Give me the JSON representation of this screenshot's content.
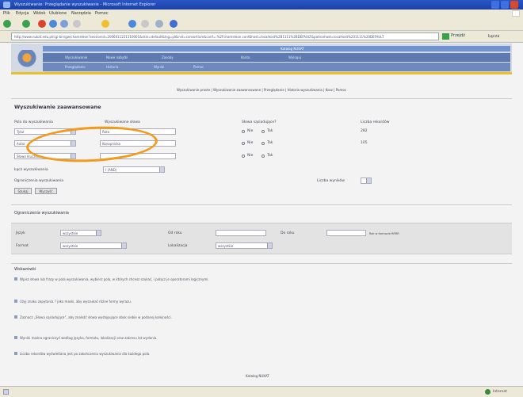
{
  "browser": {
    "title": "Wyszukiwanie: Przeglądanie wyszukiwanie - Microsoft Internet Explorer",
    "menu": [
      "Plik",
      "Edycja",
      "Widok",
      "Ulubione",
      "Narzędzia",
      "Pomoc"
    ],
    "address": "http://www.nukat.edu.pl/cgi-bin/gw/chameleon?sessionid=2006011221110001&skin=default&lng=pl&inst=consortium&conf=.%2Fchameleon.conf&host=localhost%2B1111%2BDEFAULT&patronhost=localhost%201111%20DEFAULT",
    "go_label": "Przejdź",
    "links_label": "Łącza",
    "status_right": "Internet"
  },
  "header": {
    "banner_text": "Katalog NUKAT",
    "nav_row1": [
      "Wyszukiwanie",
      "Nowe nabytki",
      "Zasoby",
      "Konto",
      "Wyloguj"
    ],
    "nav_row2": [
      "Przeglądanie",
      "Historia",
      "Wyniki",
      "Pomoc"
    ]
  },
  "subnav": "Wyszukiwanie proste | Wyszukiwanie zaawansowane | Przeglądanie | Historia wyszukiwania | Kosz | Pomoc",
  "form": {
    "heading": "Wyszukiwanie zaawansowane",
    "col_field": "Pola do wyszukiwania",
    "col_terms": "Wyszukiwane słowa",
    "col_adjacent": "Słowa sąsiadujące?",
    "col_count": "Liczba rekordów",
    "rows": [
      {
        "field": "Tytuł",
        "term": "Rota",
        "yes": "Tak",
        "no": "Nie",
        "count": "282"
      },
      {
        "field": "Autor",
        "term": "Konopnicka",
        "yes": "Tak",
        "no": "Nie",
        "count": "105"
      },
      {
        "field": "Słowo kluczowe",
        "term": "",
        "yes": "Tak",
        "no": "Nie",
        "count": ""
      }
    ],
    "bool_label": "Łącz wyszukiwania",
    "bool_value": "I (AND)",
    "limit_label": "Ograniczenia wyszukiwania",
    "limit_right": "Liczba wyników",
    "submit": "Szukaj",
    "reset": "Wyczyść"
  },
  "filters": {
    "title": "Ograniczenia wyszukiwania",
    "lang_label": "Język",
    "lang_value": "wszystkie",
    "year_from": "Od roku",
    "year_to": "Do roku",
    "format_label": "Format",
    "format_value": "wszystkie",
    "location_label": "Lokalizacja",
    "location_value": "wszystkie",
    "hint": "Rok w formacie RRRR"
  },
  "help": {
    "title": "Wskazówki",
    "items": [
      "Wpisz słowa lub frazy w pola wyszukiwania, wybierz pola, w których chcesz szukać, i połącz je operatorami logicznymi.",
      "Użyj znaku zapytania ? jako maski, aby wyszukać różne formy wyrazu.",
      "Zaznacz „Słowa sąsiadujące”, aby znaleźć słowa występujące obok siebie w podanej kolejności.",
      "Wyniki można ograniczyć według języka, formatu, lokalizacji oraz zakresu lat wydania.",
      "Liczba rekordów wyświetlana jest po zakończeniu wyszukiwania dla każdego pola."
    ],
    "footer": "Katalog NUKAT"
  }
}
